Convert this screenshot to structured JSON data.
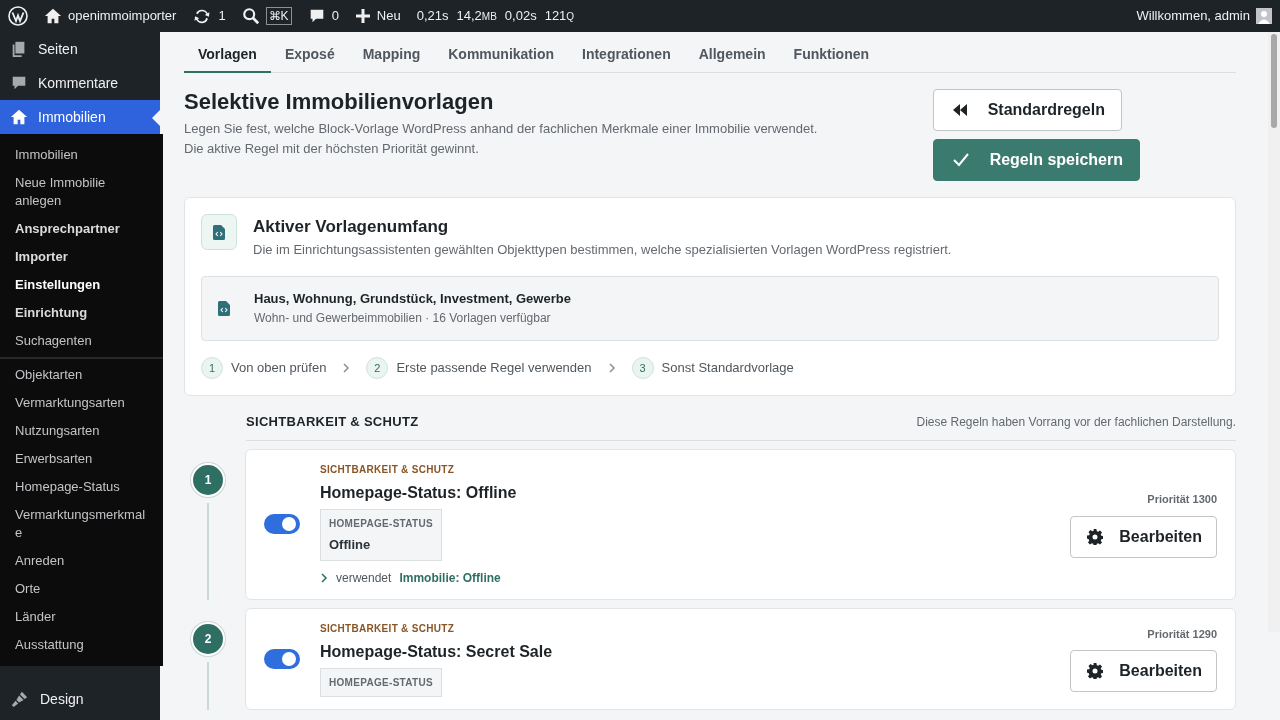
{
  "admin_bar": {
    "site": "openimmoimporter",
    "updates": "1",
    "search_shortcut": "⌘K",
    "comments": "0",
    "new_label": "Neu",
    "stats": [
      {
        "value": "0,21s"
      },
      {
        "value": "14,2",
        "unit": "MB"
      },
      {
        "value": "0,02s"
      },
      {
        "value": "121",
        "unit": "Q"
      }
    ],
    "greeting": "Willkommen, admin"
  },
  "sidebar": {
    "items": [
      {
        "label": "Seiten",
        "kind": "pages",
        "selected": false
      },
      {
        "label": "Kommentare",
        "kind": "comment",
        "selected": false
      },
      {
        "label": "Immobilien",
        "kind": "home",
        "selected": true
      }
    ],
    "submenu_groups": [
      [
        {
          "label": "Immobilien",
          "emphasized": false,
          "selected": false
        },
        {
          "label": "Neue Immobilie anlegen",
          "emphasized": false,
          "selected": false
        },
        {
          "label": "Ansprechpartner",
          "emphasized": true,
          "selected": false
        },
        {
          "label": "Importer",
          "emphasized": true,
          "selected": false
        },
        {
          "label": "Einstellungen",
          "emphasized": true,
          "selected": true
        },
        {
          "label": "Einrichtung",
          "emphasized": true,
          "selected": false
        },
        {
          "label": "Suchagenten",
          "emphasized": false,
          "selected": false
        }
      ],
      [
        {
          "label": "Objektarten",
          "emphasized": false,
          "selected": false
        },
        {
          "label": "Vermarktungsarten",
          "emphasized": false,
          "selected": false
        },
        {
          "label": "Nutzungsarten",
          "emphasized": false,
          "selected": false
        },
        {
          "label": "Erwerbsarten",
          "emphasized": false,
          "selected": false
        },
        {
          "label": "Homepage-Status",
          "emphasized": false,
          "selected": false
        },
        {
          "label": "Vermarktungsmerkmale",
          "emphasized": false,
          "selected": false
        },
        {
          "label": "Anreden",
          "emphasized": false,
          "selected": false
        },
        {
          "label": "Orte",
          "emphasized": false,
          "selected": false
        },
        {
          "label": "Länder",
          "emphasized": false,
          "selected": false
        },
        {
          "label": "Ausstattung",
          "emphasized": false,
          "selected": false
        }
      ]
    ],
    "bottom_items": [
      {
        "label": "Design",
        "kind": "brush",
        "selected": false
      }
    ]
  },
  "tabs": [
    {
      "label": "Vorlagen",
      "selected": true
    },
    {
      "label": "Exposé",
      "selected": false
    },
    {
      "label": "Mapping",
      "selected": false
    },
    {
      "label": "Kommunikation",
      "selected": false
    },
    {
      "label": "Integrationen",
      "selected": false
    },
    {
      "label": "Allgemein",
      "selected": false
    },
    {
      "label": "Funktionen",
      "selected": false
    }
  ],
  "header": {
    "title": "Selektive Immobilienvorlagen",
    "description": [
      "Legen Sie fest, welche Block-Vorlage WordPress anhand der fachlichen Merkmale einer Immobilie verwendet.",
      "Die aktive Regel mit der höchsten Priorität gewinnt."
    ],
    "buttons": [
      {
        "label": "Standardregeln",
        "kind": "reset"
      },
      {
        "label": "Regeln speichern",
        "kind": "save"
      }
    ]
  },
  "scope": {
    "title": "Aktiver Vorlagenumfang",
    "description": "Die im Einrichtungsassistenten gewählten Objekttypen bestimmen, welche spezialisierten Vorlagen WordPress registriert.",
    "types": "Haus, Wohnung, Grundstück, Investment, Gewerbe",
    "summary": "Wohn- und Gewerbeimmobilien · 16 Vorlagen verfügbar",
    "steps": [
      {
        "number": "1",
        "label": "Von oben prüfen"
      },
      {
        "number": "2",
        "label": "Erste passende Regel verwenden"
      },
      {
        "number": "3",
        "label": "Sonst Standardvorlage"
      }
    ]
  },
  "section": {
    "title": "SICHTBARKEIT & SCHUTZ",
    "note": "Diese Regeln haben Vorrang vor der fachlichen Darstellung."
  },
  "rules": [
    {
      "number": "1",
      "on": true,
      "category": "SICHTBARKEIT & SCHUTZ",
      "title": "Homepage-Status: Offline",
      "condition_label": "HOMEPAGE-STATUS",
      "condition_value": "Offline",
      "uses_label": "verwendet",
      "uses_template": "Immobilie: Offline",
      "priority": "Priorität 1300",
      "edit_label": "Bearbeiten"
    },
    {
      "number": "2",
      "on": true,
      "category": "SICHTBARKEIT & SCHUTZ",
      "title": "Homepage-Status: Secret Sale",
      "condition_label": "HOMEPAGE-STATUS",
      "priority": "Priorität 1290",
      "edit_label": "Bearbeiten"
    }
  ]
}
